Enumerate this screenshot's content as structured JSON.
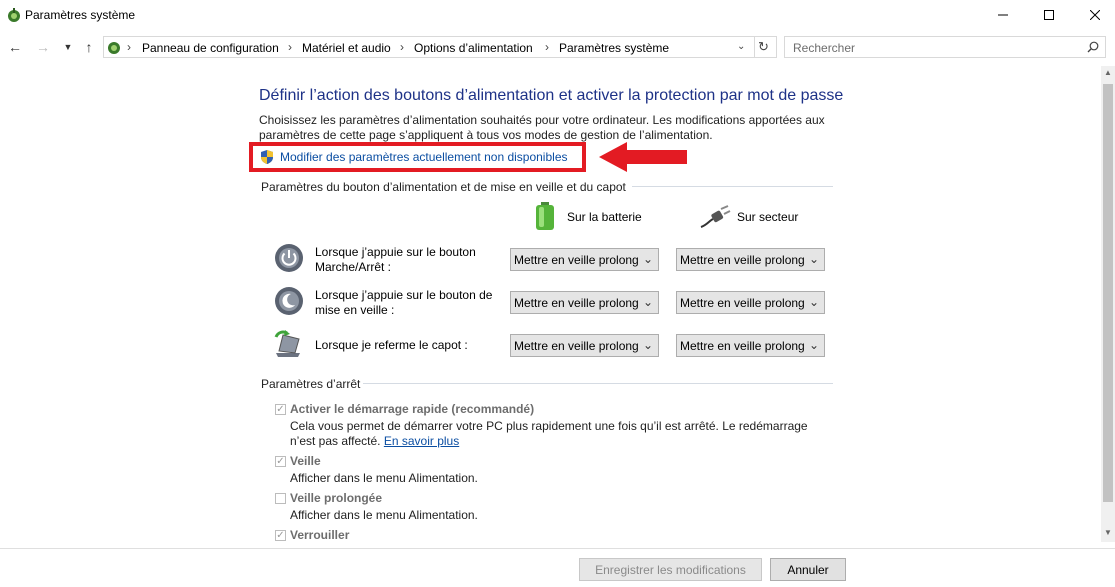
{
  "window": {
    "title": "Paramètres système"
  },
  "address_bar": {
    "breadcrumbs": [
      "Panneau de configuration",
      "Matériel et audio",
      "Options d’alimentation",
      "Paramètres système"
    ]
  },
  "search": {
    "placeholder": "Rechercher"
  },
  "page": {
    "heading": "Définir l’action des boutons d’alimentation et activer la protection par mot de passe",
    "intro": "Choisissez les paramètres d’alimentation souhaités pour votre ordinateur. Les modifications apportées aux paramètres de cette page s’appliquent à tous vos modes de gestion de l’alimentation.",
    "admin_link": "Modifier des paramètres actuellement non disponibles"
  },
  "power_buttons": {
    "section_title": "Paramètres du bouton d’alimentation et de mise en veille et du capot",
    "col_battery": "Sur la batterie",
    "col_ac": "Sur secteur",
    "rows": [
      {
        "label": "Lorsque j’appuie sur le bouton Marche/Arrêt :",
        "battery": "Mettre en veille prolong",
        "ac": "Mettre en veille prolong"
      },
      {
        "label": "Lorsque j’appuie sur le bouton de mise en veille :",
        "battery": "Mettre en veille prolong",
        "ac": "Mettre en veille prolong"
      },
      {
        "label": "Lorsque je referme le capot :",
        "battery": "Mettre en veille prolong",
        "ac": "Mettre en veille prolong"
      }
    ]
  },
  "shutdown": {
    "section_title": "Paramètres d’arrêt",
    "fast_startup": {
      "label": "Activer le démarrage rapide (recommandé)",
      "checked": true,
      "desc": "Cela vous permet de démarrer votre PC plus rapidement une fois qu’il est arrêté. Le redémarrage n’est pas affecté.",
      "learn_more": "En savoir plus"
    },
    "sleep": {
      "label": "Veille",
      "checked": true,
      "desc": "Afficher dans le menu Alimentation."
    },
    "hibernate": {
      "label": "Veille prolongée",
      "checked": false,
      "desc": "Afficher dans le menu Alimentation."
    },
    "lock": {
      "label": "Verrouiller",
      "checked": true
    }
  },
  "buttons": {
    "save": "Enregistrer les modifications",
    "cancel": "Annuler"
  },
  "colors": {
    "heading": "#1e3287",
    "link": "#0b4ea2",
    "highlight": "#e31b23"
  }
}
